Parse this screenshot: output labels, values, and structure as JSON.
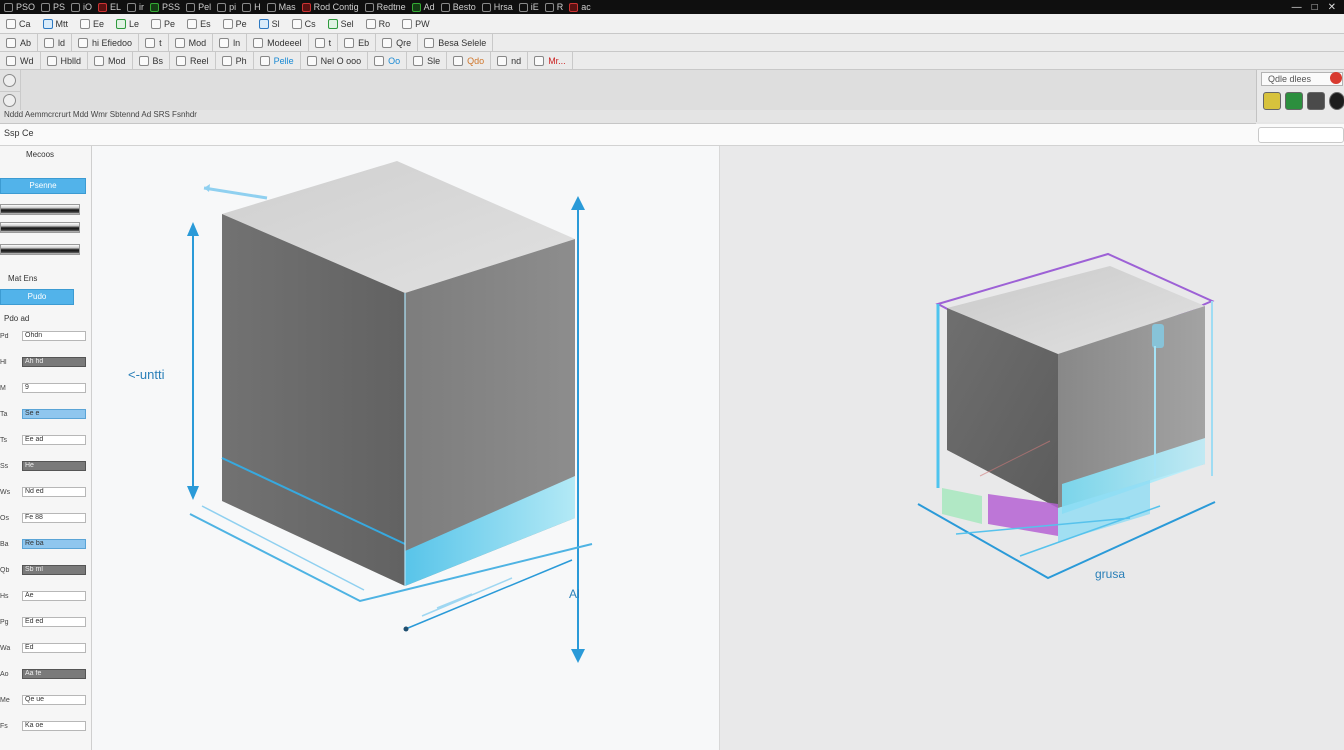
{
  "title_bar": {
    "items": [
      "PSO",
      "PS",
      "iO",
      "EL",
      "ir",
      "PSS",
      "Pel",
      "pi",
      "H",
      "Mas",
      "Rod Contig",
      "Redtne",
      "Ad",
      "Besto",
      "Hrsa",
      "iE",
      "R",
      "ac"
    ],
    "right_buttons": [
      "—",
      "□",
      "✕"
    ]
  },
  "toolbar_row1": {
    "items": [
      "Ca",
      "Mtt",
      "Ee",
      "Le",
      "Pe",
      "Es",
      "Pe",
      "Sl",
      "Cs",
      "Sel",
      "Ro",
      "PW"
    ]
  },
  "toolbar_row2": {
    "items": [
      "Ab",
      "ld",
      "hi Efiedoo",
      "t",
      "Mod",
      "ln",
      "Modeeel",
      "t",
      "Eb",
      "Qre",
      "Besa Selele"
    ]
  },
  "toolbar_row3": {
    "items": [
      "Wd",
      "Hblld",
      "Mod",
      "Bs",
      "Reel",
      "Ph",
      "Pelle",
      "Nel O ooo",
      "Oo",
      "Sle",
      "Qdo",
      "nd",
      "Mr..."
    ]
  },
  "ribbon": {
    "breadcrumb": "Nddd Aemmcrcrurt Mdd Wmr Sbtennd Ad SRS Fsnhdr",
    "panel_caption": "Ssp Ce",
    "right_field": "Qdle dlees"
  },
  "left_panel": {
    "caption": "Mecoos",
    "blue_field_1": "Psenne",
    "sub_label": "Mat Ens",
    "blue_field_2": "Pudo",
    "heading": "Pdo ad",
    "rows": [
      {
        "label": "Pd",
        "value": "Ohdn"
      },
      {
        "label": "Hl",
        "value": "Ah hd"
      },
      {
        "label": "M",
        "value": "9"
      },
      {
        "label": "Ta",
        "value": "Se e"
      },
      {
        "label": "Ts",
        "value": "Ee ad"
      },
      {
        "label": "Ss",
        "value": "He"
      },
      {
        "label": "Ws",
        "value": "Nd ed"
      },
      {
        "label": "Os",
        "value": "Fe 88"
      },
      {
        "label": "Ba",
        "value": "Re ba"
      },
      {
        "label": "Qb",
        "value": "Sb ml"
      },
      {
        "label": "Hs",
        "value": "Ae"
      },
      {
        "label": "Pg",
        "value": "Ed ed"
      },
      {
        "label": "Wa",
        "value": "Ed"
      },
      {
        "label": "Ao",
        "value": "Aa fe"
      },
      {
        "label": "Me",
        "value": "Qe ue"
      },
      {
        "label": "Fs",
        "value": "Ka oe"
      }
    ]
  },
  "viewport_left": {
    "dimension_label": "<-untti",
    "side_label": "Al"
  },
  "viewport_right": {
    "bottom_label": "grusa"
  },
  "colors": {
    "accent_blue": "#2a9ad8",
    "box_face_front": "#6e6e6e",
    "box_face_top": "#d3d3d3",
    "highlight_cyan": "#66d7f3",
    "highlight_purple": "#8a3fd1"
  }
}
